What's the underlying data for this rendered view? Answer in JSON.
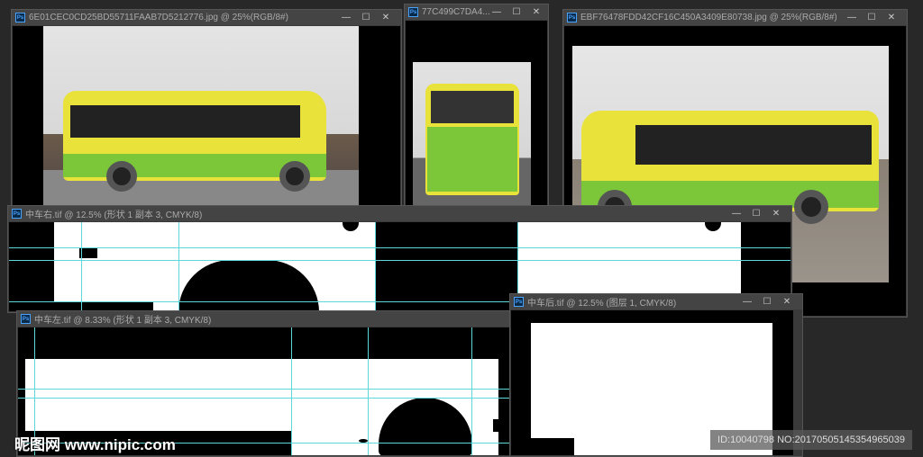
{
  "windows": [
    {
      "title": "6E01CEC0CD25BD55711FAAB7D5212776.jpg @ 25%(RGB/8#)"
    },
    {
      "title": "77C499C7DA4..."
    },
    {
      "title": "EBF76478FDD42CF16C450A3409E80738.jpg @ 25%(RGB/8#)"
    },
    {
      "title": "中车右.tif @ 12.5% (形状 1 副本 3, CMYK/8)"
    },
    {
      "title": "中车左.tif @ 8.33% (形状 1 副本 3, CMYK/8)"
    },
    {
      "title": "中车后.tif @ 12.5% (图层 1, CMYK/8)"
    }
  ],
  "controls": {
    "minimize": "—",
    "maximize": "☐",
    "close": "✕"
  },
  "ps_badge": "Ps",
  "watermark": {
    "logo": "昵图网 www.nipic.com",
    "id": "ID:10040798 NO:20170505145354965039"
  },
  "colors": {
    "bus_yellow": "#e8e23a",
    "bus_green": "#7cc63a",
    "guide": "#5fd6d8"
  }
}
